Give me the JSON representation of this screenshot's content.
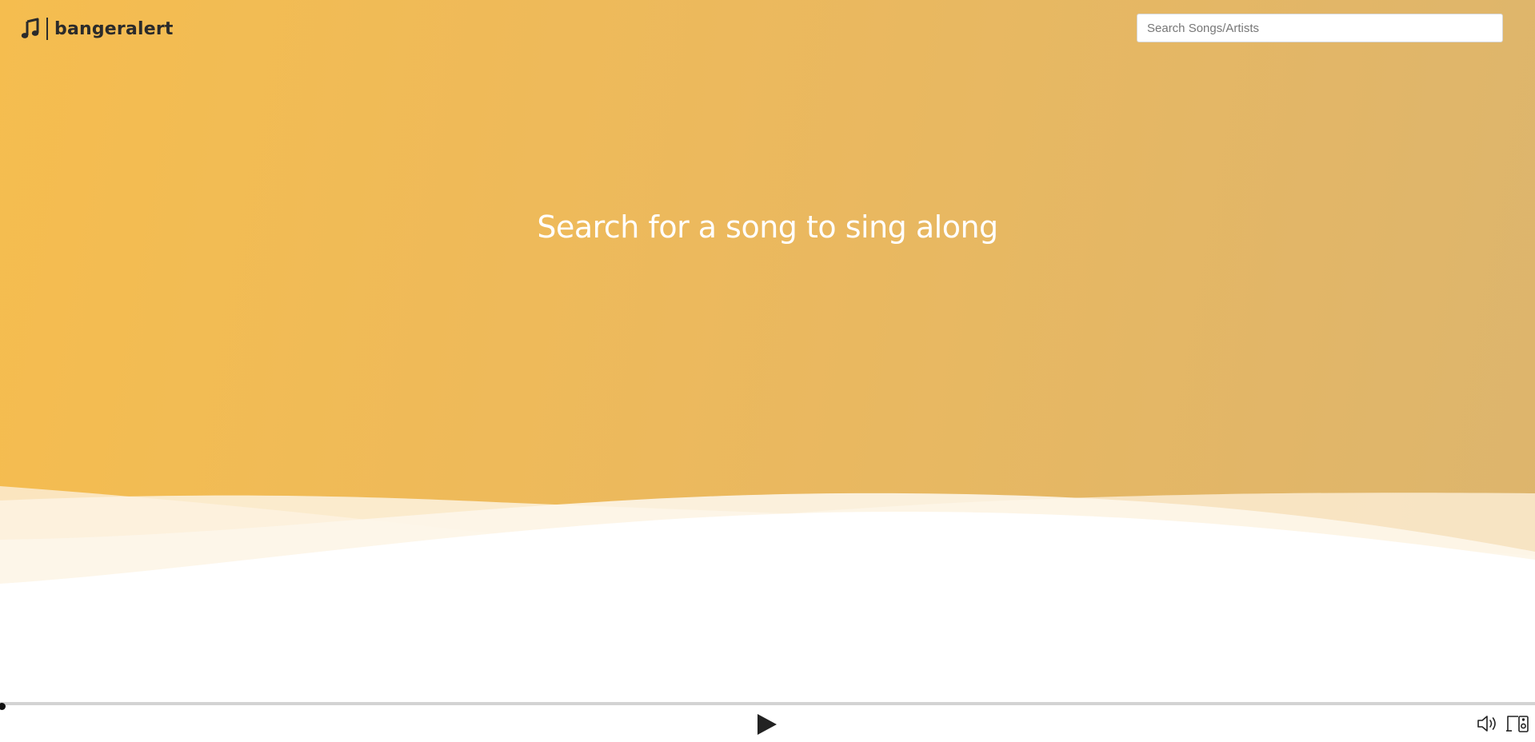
{
  "header": {
    "brand_name": "bangeralert",
    "brand_icon": "music-note-icon"
  },
  "search": {
    "placeholder": "Search Songs/Artists",
    "value": ""
  },
  "hero": {
    "title": "Search for a song to sing along"
  },
  "player": {
    "progress": 0,
    "play_icon": "play-icon",
    "volume_icon": "volume-icon",
    "devices_icon": "devices-icon"
  },
  "colors": {
    "hero_start": "#f5bd4f",
    "hero_end": "#ddb56d",
    "text_dark": "#2b2b2b",
    "player_icon": "#222222"
  }
}
